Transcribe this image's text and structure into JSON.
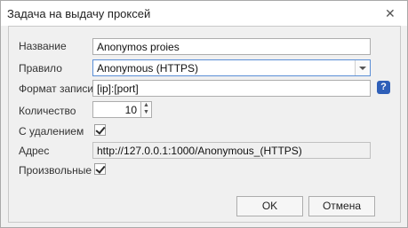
{
  "window": {
    "title": "Задача на выдачу проксей",
    "close_glyph": "✕"
  },
  "form": {
    "name": {
      "label": "Название",
      "value": "Anonymos proies"
    },
    "rule": {
      "label": "Правило",
      "value": "Anonymous (HTTPS)"
    },
    "format": {
      "label": "Формат записи",
      "value": "[ip]:[port]",
      "help_glyph": "?"
    },
    "count": {
      "label": "Количество",
      "value": "10"
    },
    "delete": {
      "label": "С удалением",
      "checked": true
    },
    "address": {
      "label": "Адрес",
      "value": "http://127.0.0.1:1000/Anonymous_(HTTPS)"
    },
    "arbitrary": {
      "label": "Произвольные",
      "checked": true
    }
  },
  "buttons": {
    "ok": "OK",
    "cancel": "Отмена"
  }
}
